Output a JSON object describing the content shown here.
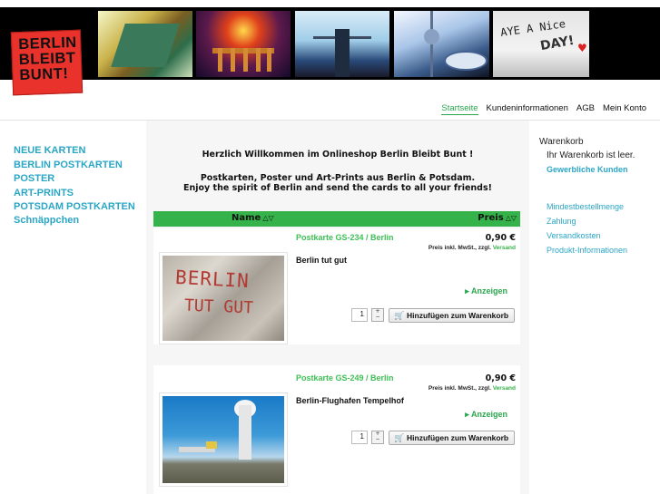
{
  "logo": {
    "line1": "BERLIN",
    "line2": "BLEIBT",
    "line3": "BUNT!"
  },
  "header_photos": {
    "graffiti_line1": "AYE  A Nice",
    "graffiti_line2": "DAY!"
  },
  "topnav": [
    "Startseite",
    "Kundeninformationen",
    "AGB",
    "Mein Konto"
  ],
  "categories": [
    "NEUE KARTEN",
    "BERLIN POSTKARTEN",
    "POSTER",
    "ART-PRINTS",
    "POTSDAM POSTKARTEN",
    "Schnäppchen"
  ],
  "welcome": {
    "line1": "Herzlich Willkommen im Onlineshop Berlin Bleibt Bunt !",
    "line2": "Postkarten, Poster und Art-Prints aus Berlin & Potsdam.",
    "line3": "Enjoy the spirit of Berlin and send the cards to all your friends!"
  },
  "listing_header": {
    "name": "Name",
    "price": "Preis",
    "sort_icon": "△▽"
  },
  "products": [
    {
      "title": "Postkarte GS-234 / Berlin",
      "price": "0,90 €",
      "price_note": "Preis inkl. MwSt., zzgl.",
      "shipping_link": "Versand",
      "description": "Berlin tut gut",
      "image_text_1": "BERLIN",
      "image_text_2": "TUT GUT",
      "show_link": "Anzeigen",
      "qty": "1",
      "add_to_cart": "Hinzufügen zum Warenkorb"
    },
    {
      "title": "Postkarte GS-249 / Berlin",
      "price": "0,90 €",
      "price_note": "Preis inkl. MwSt., zzgl.",
      "shipping_link": "Versand",
      "description": "Berlin-Flughafen Tempelhof",
      "show_link": "Anzeigen",
      "qty": "1",
      "add_to_cart": "Hinzufügen zum Warenkorb"
    }
  ],
  "cart": {
    "title": "Warenkorb",
    "empty_text": "Ihr Warenkorb ist leer.",
    "business_link": "Gewerbliche Kunden"
  },
  "info_links": [
    "Mindestbestellmenge",
    "Zahlung",
    "Versandkosten",
    "Produkt-Informationen"
  ],
  "colors": {
    "accent_green": "#35b24a",
    "link_blue": "#2ba6c6",
    "logo_red": "#e8322b"
  }
}
